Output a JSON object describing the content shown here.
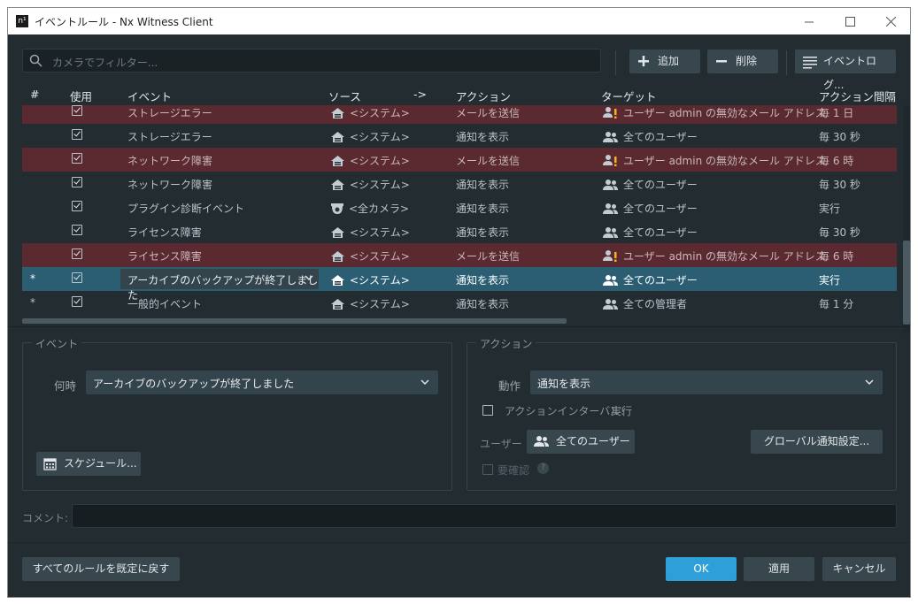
{
  "window": {
    "app_icon_text": "n¹",
    "title": "イベントルール - Nx Witness Client",
    "controls": [
      "minimize",
      "maximize",
      "close"
    ]
  },
  "toolbar": {
    "filter_placeholder": "カメラでフィルター...",
    "add_label": "追加",
    "delete_label": "削除",
    "event_log_label": "イベントログ..."
  },
  "table": {
    "headers": {
      "num": "#",
      "use": "使用",
      "event": "イベント",
      "source": "ソース",
      "arrow": "->",
      "action": "アクション",
      "target": "ターゲット",
      "interval": "アクション間隔"
    },
    "rows": [
      {
        "num": "",
        "checked": true,
        "event": "ストレージエラー",
        "source_icon": "server-icon",
        "source": "<システム>",
        "action": "メールを送信",
        "target_icon": "user-warning-icon",
        "target": "ユーザー admin の無効なメール アドレス",
        "interval": "毎 1 日",
        "state": "error"
      },
      {
        "num": "",
        "checked": true,
        "event": "ストレージエラー",
        "source_icon": "server-icon",
        "source": "<システム>",
        "action": "通知を表示",
        "target_icon": "users-icon",
        "target": "全てのユーザー",
        "interval": "毎 30 秒",
        "state": "normal"
      },
      {
        "num": "",
        "checked": true,
        "event": "ネットワーク障害",
        "source_icon": "server-icon",
        "source": "<システム>",
        "action": "メールを送信",
        "target_icon": "user-warning-icon",
        "target": "ユーザー admin の無効なメール アドレス",
        "interval": "毎 6 時",
        "state": "error"
      },
      {
        "num": "",
        "checked": true,
        "event": "ネットワーク障害",
        "source_icon": "server-icon",
        "source": "<システム>",
        "action": "通知を表示",
        "target_icon": "users-icon",
        "target": "全てのユーザー",
        "interval": "毎 30 秒",
        "state": "normal"
      },
      {
        "num": "",
        "checked": true,
        "event": "プラグイン診断イベント",
        "source_icon": "camera-icon",
        "source": "<全カメラ>",
        "action": "通知を表示",
        "target_icon": "users-icon",
        "target": "全てのユーザー",
        "interval": "実行",
        "state": "normal"
      },
      {
        "num": "",
        "checked": true,
        "event": "ライセンス障害",
        "source_icon": "server-icon",
        "source": "<システム>",
        "action": "通知を表示",
        "target_icon": "users-icon",
        "target": "全てのユーザー",
        "interval": "毎 30 秒",
        "state": "normal"
      },
      {
        "num": "",
        "checked": true,
        "event": "ライセンス障害",
        "source_icon": "server-icon",
        "source": "<システム>",
        "action": "メールを送信",
        "target_icon": "user-warning-icon",
        "target": "ユーザー admin の無効なメール アドレス",
        "interval": "毎 6 時",
        "state": "error"
      },
      {
        "num": "*",
        "checked": true,
        "event": "アーカイブのバックアップが終了しました",
        "source_icon": "server-icon",
        "source": "<システム>",
        "action": "通知を表示",
        "target_icon": "users-icon",
        "target": "全てのユーザー",
        "interval": "実行",
        "state": "selected"
      },
      {
        "num": "*",
        "checked": true,
        "event": "一般的イベント",
        "source_icon": "server-icon",
        "source": "<システム>",
        "action": "通知を表示",
        "target_icon": "users-icon",
        "target": "全ての管理者",
        "interval": "毎 1 分",
        "state": "normal"
      }
    ]
  },
  "event_panel": {
    "title": "イベント",
    "when_label": "何時",
    "when_value": "アーカイブのバックアップが終了しました",
    "schedule_label": "スケジュール..."
  },
  "action_panel": {
    "title": "アクション",
    "do_label": "動作",
    "do_value": "通知を表示",
    "interval_checkbox_label": "アクションインターバル:",
    "interval_value": "実行",
    "user_label": "ユーザー",
    "user_value": "全てのユーザー",
    "global_notify_label": "グローバル通知設定...",
    "confirm_label": "要確認",
    "help_icon_text": "?"
  },
  "comment": {
    "label": "コメント:",
    "value": ""
  },
  "footer": {
    "reset_label": "すべてのルールを既定に戻す",
    "ok_label": "OK",
    "apply_label": "適用",
    "cancel_label": "キャンセル"
  },
  "colors": {
    "background": "#222c31",
    "error_row": "#5b2a30",
    "selected_row": "#2b5d73",
    "accent": "#2f9fd8"
  }
}
